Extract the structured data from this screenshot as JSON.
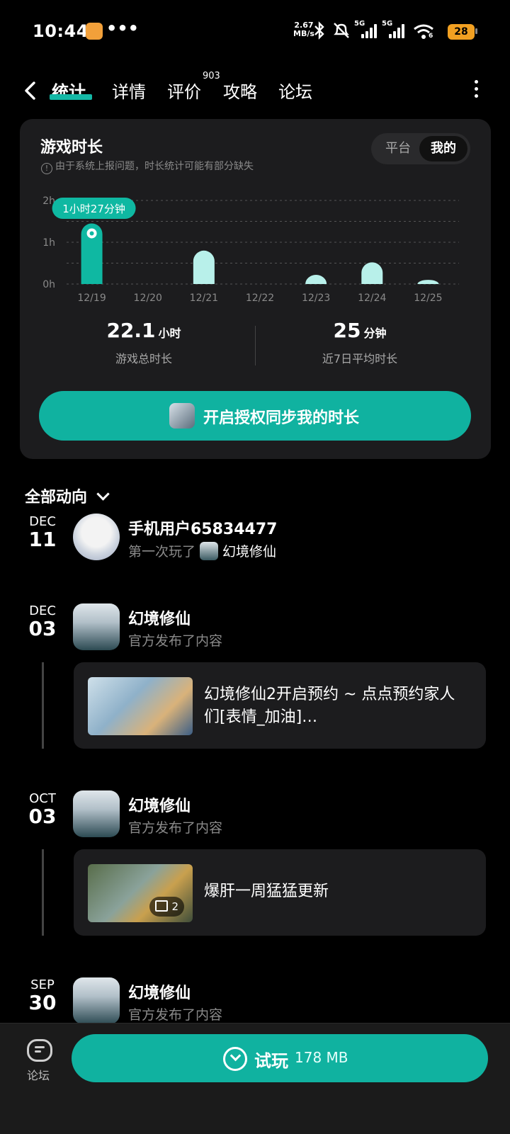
{
  "status_bar": {
    "time": "10:44",
    "dots": "•••",
    "net_speed_value": "2.67",
    "net_speed_unit": "MB/s",
    "net1": "5G",
    "net2": "5G",
    "wifi_sub": "6",
    "battery": "28"
  },
  "nav": {
    "tabs": [
      {
        "label": "统计",
        "active": true
      },
      {
        "label": "详情"
      },
      {
        "label": "评价",
        "badge": "903"
      },
      {
        "label": "攻略"
      },
      {
        "label": "论坛"
      }
    ]
  },
  "stats": {
    "title": "游戏时长",
    "note": "由于系统上报问题，时长统计可能有部分缺失",
    "toggle": {
      "platform": "平台",
      "mine": "我的"
    },
    "tooltip": "1小时27分钟",
    "total": {
      "value": "22.1",
      "unit": "小时",
      "label": "游戏总时长"
    },
    "average": {
      "value": "25",
      "unit": "分钟",
      "label": "近7日平均时长"
    },
    "sync_button": "开启授权同步我的时长"
  },
  "chart_data": {
    "type": "bar",
    "title": "",
    "categories": [
      "12/19",
      "12/20",
      "12/21",
      "12/22",
      "12/23",
      "12/24",
      "12/25"
    ],
    "values": [
      1.45,
      0,
      0.8,
      0,
      0.22,
      0.52,
      0.1
    ],
    "unit": "hours",
    "ylim": [
      0,
      2
    ],
    "yticks": [
      "0h",
      "1h",
      "2h"
    ],
    "grid": true,
    "highlight_index": 0,
    "bar_color": "#0fb8a2",
    "faded_color": "#b8f0ea"
  },
  "feed": {
    "filter_label": "全部动向",
    "items": [
      {
        "month": "DEC",
        "day": "11",
        "name": "手机用户65834477",
        "sub": "第一次玩了",
        "game": "幻境修仙"
      },
      {
        "month": "DEC",
        "day": "03",
        "name": "幻境修仙",
        "sub": "官方发布了内容",
        "post": "幻境修仙2开启预约 ~ 点点预约家人们[表情_加油] https://www.taptap.cn/app/..."
      },
      {
        "month": "OCT",
        "day": "03",
        "name": "幻境修仙",
        "sub": "官方发布了内容",
        "post": "爆肝一周猛猛更新",
        "img_count": "2"
      },
      {
        "month": "SEP",
        "day": "30",
        "name": "幻境修仙",
        "sub": "官方发布了内容"
      }
    ]
  },
  "bottom_bar": {
    "forum_label": "论坛",
    "play_label": "试玩",
    "play_size": "178 MB"
  }
}
